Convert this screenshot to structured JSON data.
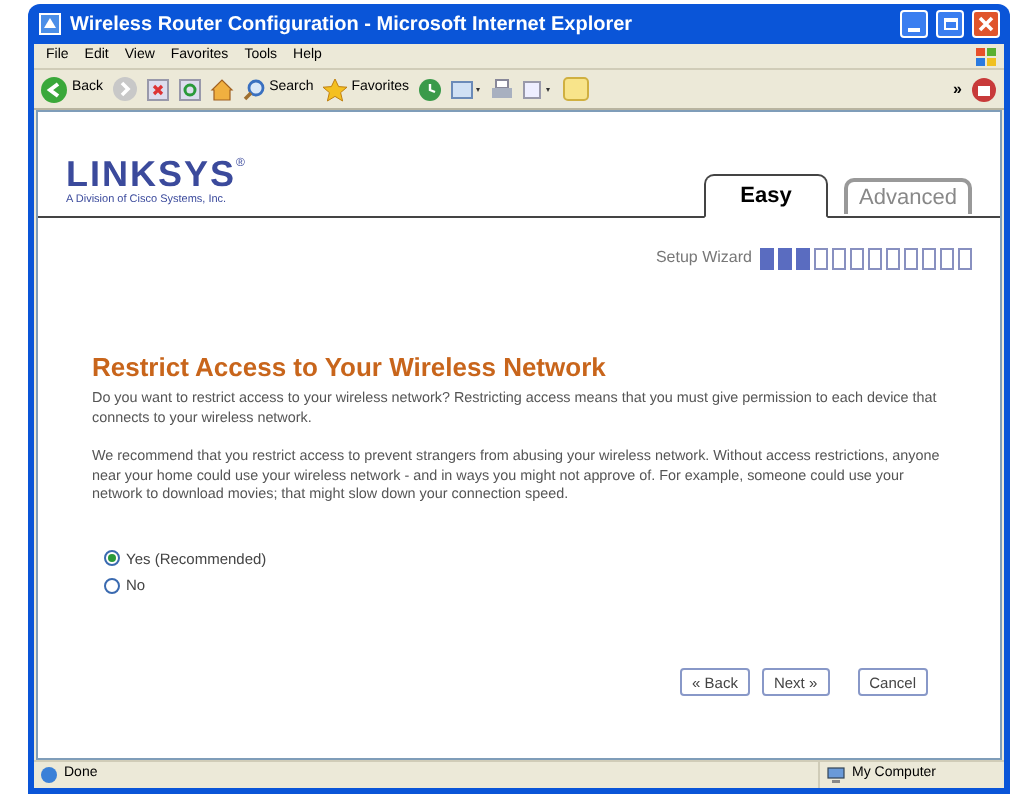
{
  "window": {
    "title": "Wireless Router Configuration - Microsoft Internet Explorer"
  },
  "menu": [
    "File",
    "Edit",
    "View",
    "Favorites",
    "Tools",
    "Help"
  ],
  "toolbar": {
    "back_label": "Back",
    "search_label": "Search",
    "favorites_label": "Favorites",
    "overflow": "»"
  },
  "logo": {
    "brand": "LINKSYS",
    "registered": "®",
    "subtitle": "A Division of Cisco Systems, Inc."
  },
  "tabs": [
    {
      "label": "Easy",
      "selected": true
    },
    {
      "label": "Advanced",
      "selected": false
    }
  ],
  "wizard": {
    "label": "Setup Wizard",
    "steps": [
      {
        "filled": true
      },
      {
        "filled": true
      },
      {
        "filled": true
      },
      {
        "filled": false
      },
      {
        "filled": false
      },
      {
        "filled": false
      },
      {
        "filled": false
      },
      {
        "filled": false
      },
      {
        "filled": false
      },
      {
        "filled": false
      },
      {
        "filled": false
      },
      {
        "filled": false
      }
    ]
  },
  "heading": "Restrict Access to Your Wireless Network",
  "paragraphs": [
    "Do you want to restrict access to your wireless network? Restricting access means that you must give permission to each device that connects to your wireless network.",
    "We recommend that you restrict access to prevent strangers from abusing your wireless network. Without access restrictions, anyone near your home could use your wireless network - and in ways you might not approve of. For example, someone could use your network to download movies; that might slow down your connection speed."
  ],
  "options": [
    {
      "label": "Yes (Recommended)",
      "selected": true
    },
    {
      "label": "No",
      "selected": false
    }
  ],
  "buttons": [
    "« Back",
    "Next »",
    "Cancel"
  ],
  "status_bar": {
    "status": "Done",
    "zone": "My Computer"
  }
}
